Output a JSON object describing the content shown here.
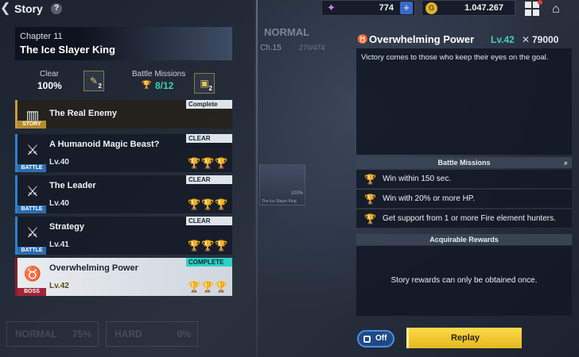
{
  "header": {
    "title": "Story",
    "help": "?",
    "gems": "774",
    "gold": "1.047.267"
  },
  "chapter": {
    "number": "Chapter 11",
    "name": "The Ice Slayer King",
    "clear_label": "Clear",
    "clear_value": "100%",
    "clear_badge": "2",
    "missions_label": "Battle Missions",
    "missions_value": "8/12",
    "missions_badge": "2"
  },
  "stages": [
    {
      "name": "The Real Enemy",
      "tag": "STORY",
      "status": "Complete",
      "level": "",
      "trophies": []
    },
    {
      "name": "A Humanoid Magic Beast?",
      "tag": "BATTLE",
      "status": "CLEAR",
      "level": "Lv.40",
      "trophies": [
        true,
        true,
        false
      ]
    },
    {
      "name": "The Leader",
      "tag": "BATTLE",
      "status": "CLEAR",
      "level": "Lv.40",
      "trophies": [
        false,
        true,
        false
      ]
    },
    {
      "name": "Strategy",
      "tag": "BATTLE",
      "status": "CLEAR",
      "level": "Lv.41",
      "trophies": [
        true,
        true,
        false
      ]
    },
    {
      "name": "Overwhelming Power",
      "tag": "BOSS",
      "status": "COMPLETE",
      "level": "Lv.42",
      "trophies": [
        true,
        true,
        true
      ]
    }
  ],
  "faded_tabs": {
    "normal": "NORMAL",
    "normal_pct": "75%",
    "hard": "HARD",
    "hard_pct": "0%"
  },
  "background": {
    "mode": "NORMAL",
    "chapter": "Ch.15",
    "progress": "270/474",
    "thumb_pct": "100%",
    "thumb_name": "The Ice Slayer King"
  },
  "detail": {
    "title": "Overwhelming Power",
    "level": "Lv.42",
    "power": "79000",
    "description": "Victory comes to those who keep their eyes on the goal.",
    "missions_header": "Battle Missions",
    "missions": [
      "Win within 150 sec.",
      "Win with 20% or more HP.",
      "Get support from 1 or more Fire element hunters."
    ],
    "rewards_header": "Acquirable Rewards",
    "rewards_text": "Story rewards can only be obtained once.",
    "auto_label": "Off",
    "replay_label": "Replay"
  },
  "icons": {
    "trophy": "trophy-icon",
    "gem": "gem-icon",
    "gold": "gold-coin-icon"
  },
  "colors": {
    "accent": "#3fd0b8",
    "gold": "#e2b12f",
    "replay": "#ffd94a"
  }
}
